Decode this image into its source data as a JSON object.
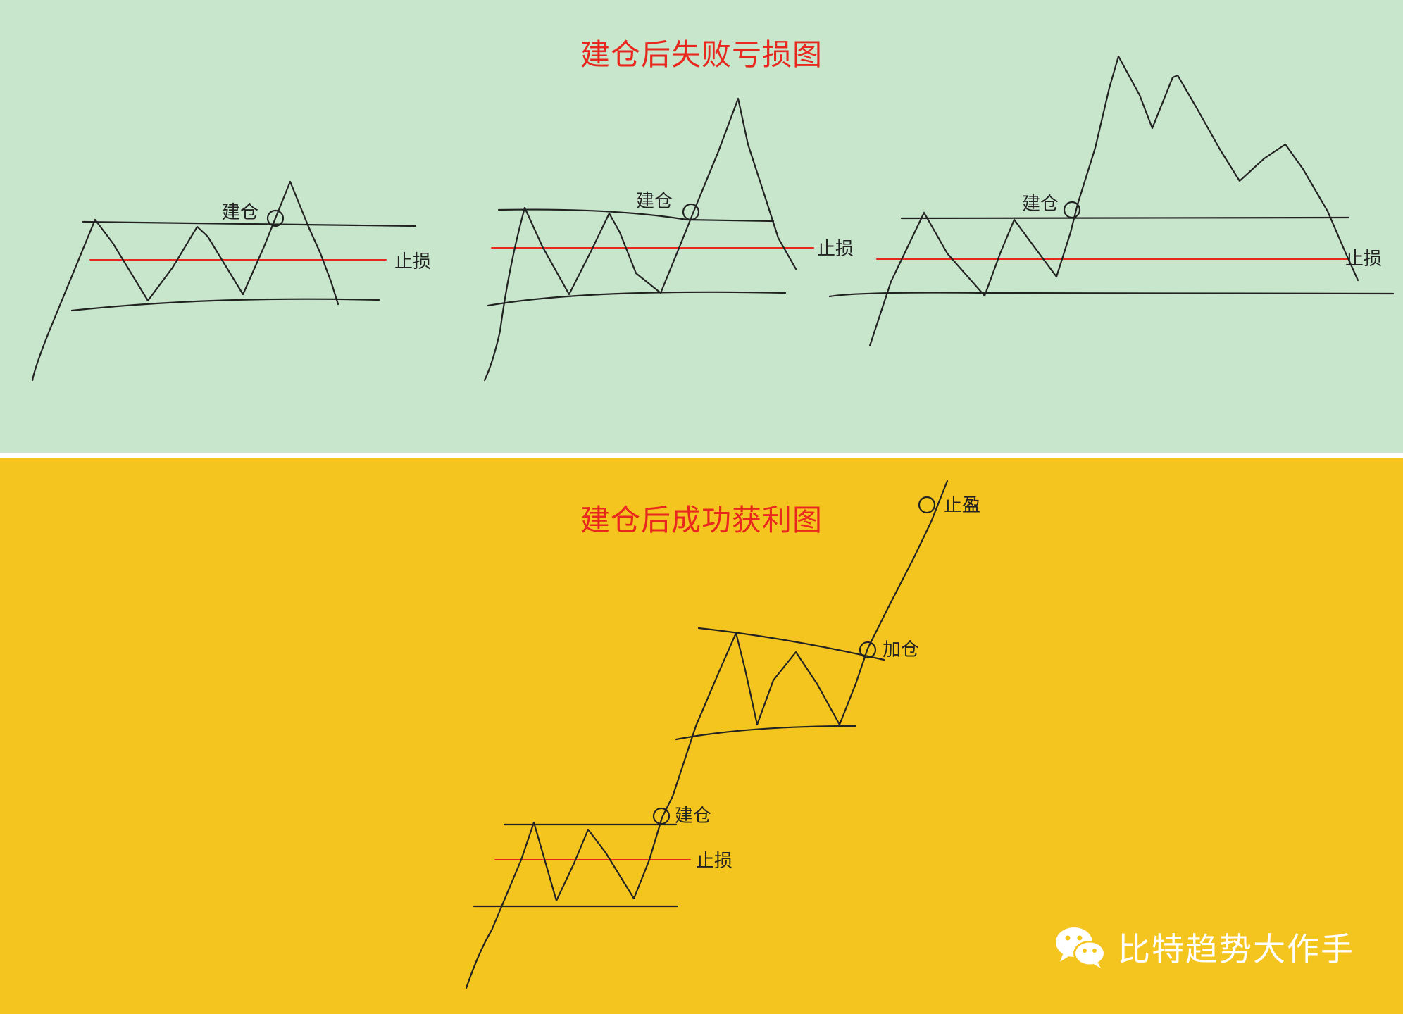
{
  "top_panel": {
    "title": "建仓后失败亏损图",
    "charts": [
      {
        "entry_label": "建仓",
        "stop_label": "止损"
      },
      {
        "entry_label": "建仓",
        "stop_label": "止损"
      },
      {
        "entry_label": "建仓",
        "stop_label": "止损"
      }
    ]
  },
  "bottom_panel": {
    "title": "建仓后成功获利图",
    "entry_label": "建仓",
    "stop_label": "止损",
    "add_label": "加仓",
    "take_profit_label": "止盈"
  },
  "watermark": {
    "text": "比特趋势大作手",
    "icon": "wechat-icon"
  },
  "colors": {
    "top_background": "#c8e6cb",
    "bottom_background": "#f5c51f",
    "title": "#e8281e",
    "stop_line": "#e8281e",
    "ink": "#222222"
  }
}
